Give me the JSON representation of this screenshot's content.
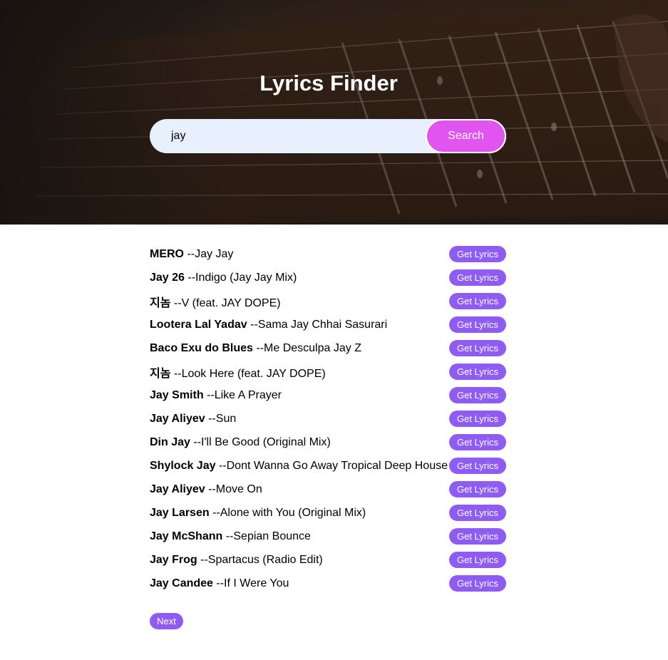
{
  "header": {
    "title": "Lyrics Finder"
  },
  "search": {
    "value": "jay",
    "button_label": "Search"
  },
  "results": [
    {
      "artist": "MERO",
      "title": "--Jay Jay",
      "button_label": "Get Lyrics"
    },
    {
      "artist": "Jay 26",
      "title": "--Indigo (Jay Jay Mix)",
      "button_label": "Get Lyrics"
    },
    {
      "artist": "지놈",
      "title": "--V (feat. JAY DOPE)",
      "button_label": "Get Lyrics"
    },
    {
      "artist": "Lootera Lal Yadav",
      "title": "--Sama Jay Chhai Sasurari",
      "button_label": "Get Lyrics"
    },
    {
      "artist": "Baco Exu do Blues",
      "title": "--Me Desculpa Jay Z",
      "button_label": "Get Lyrics"
    },
    {
      "artist": "지놈",
      "title": "--Look Here (feat. JAY DOPE)",
      "button_label": "Get Lyrics"
    },
    {
      "artist": "Jay Smith",
      "title": "--Like A Prayer",
      "button_label": "Get Lyrics"
    },
    {
      "artist": "Jay Aliyev",
      "title": "--Sun",
      "button_label": "Get Lyrics"
    },
    {
      "artist": "Din Jay",
      "title": "--I'll Be Good (Original Mix)",
      "button_label": "Get Lyrics"
    },
    {
      "artist": "Shylock Jay",
      "title": "--Dont Wanna Go Away Tropical Deep House",
      "button_label": "Get Lyrics"
    },
    {
      "artist": "Jay Aliyev",
      "title": "--Move On",
      "button_label": "Get Lyrics"
    },
    {
      "artist": "Jay Larsen",
      "title": "--Alone with You (Original Mix)",
      "button_label": "Get Lyrics"
    },
    {
      "artist": "Jay McShann",
      "title": "--Sepian Bounce",
      "button_label": "Get Lyrics"
    },
    {
      "artist": "Jay Frog",
      "title": "--Spartacus (Radio Edit)",
      "button_label": "Get Lyrics"
    },
    {
      "artist": "Jay Candee",
      "title": "--If I Were You",
      "button_label": "Get Lyrics"
    }
  ],
  "pagination": {
    "next_label": "Next"
  },
  "colors": {
    "search_button": "#e254f0",
    "lyrics_button": "#8e5cf5",
    "search_field": "#e8f0fe"
  }
}
